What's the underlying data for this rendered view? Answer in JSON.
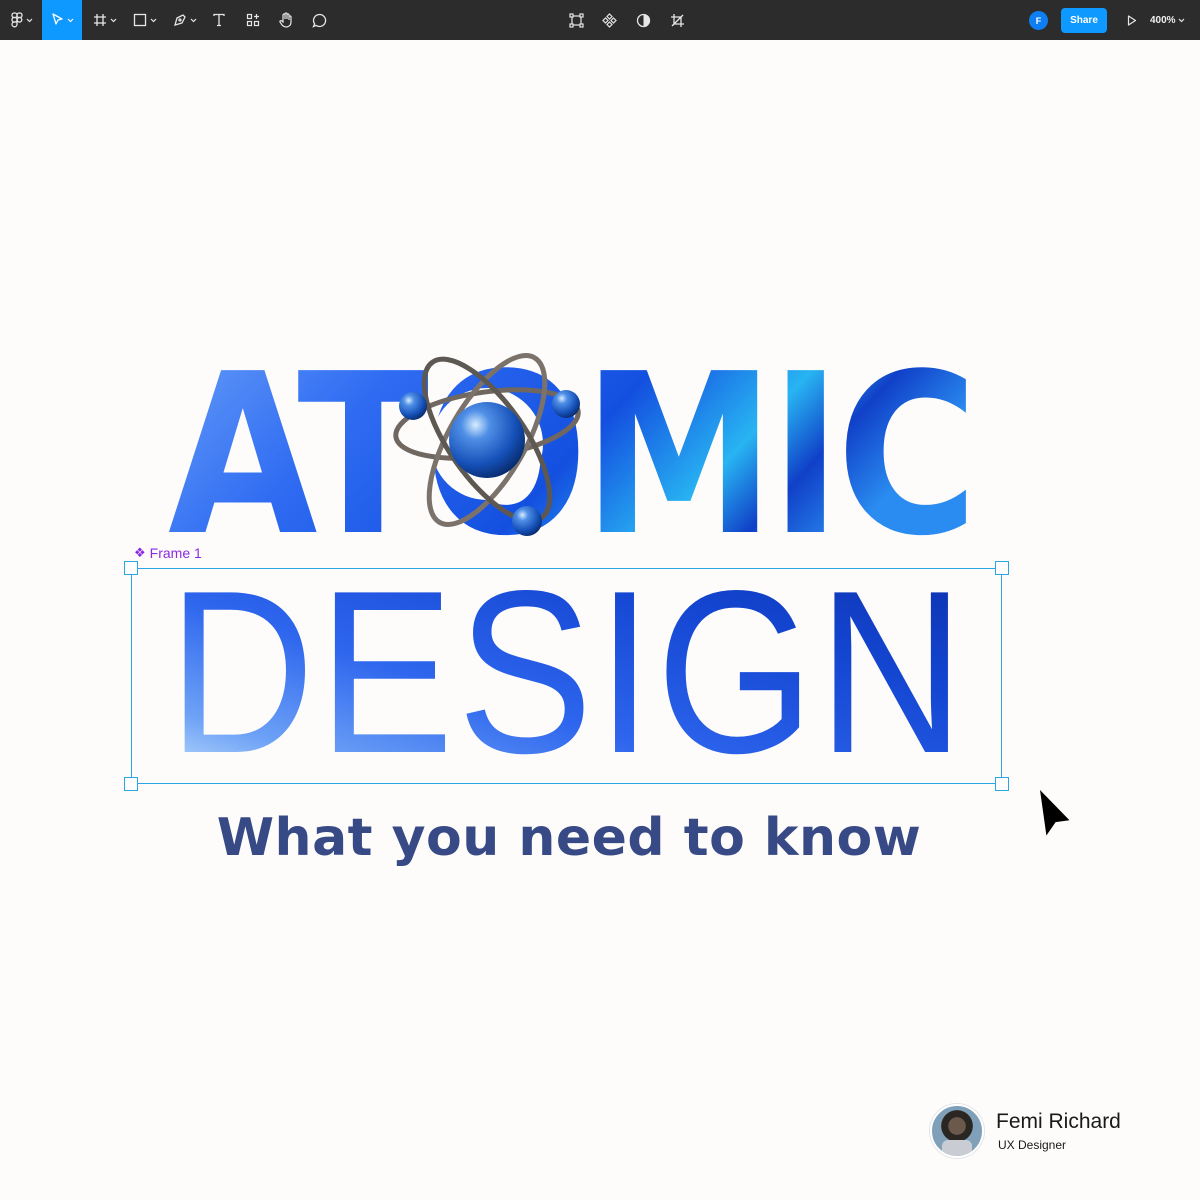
{
  "toolbar": {
    "user_initial": "F",
    "share_label": "Share",
    "zoom_level": "400%",
    "accent_color": "#0d99ff",
    "tools": [
      {
        "name": "main-menu",
        "icon": "figma-logo-icon"
      },
      {
        "name": "move",
        "icon": "move-arrow-icon",
        "active": true
      },
      {
        "name": "frame",
        "icon": "frame-hash-icon"
      },
      {
        "name": "shape",
        "icon": "rectangle-icon"
      },
      {
        "name": "pen",
        "icon": "pen-icon"
      },
      {
        "name": "text",
        "icon": "text-icon"
      },
      {
        "name": "resources",
        "icon": "resources-icon"
      },
      {
        "name": "hand",
        "icon": "hand-icon"
      },
      {
        "name": "comment",
        "icon": "comment-icon"
      },
      {
        "name": "transform",
        "icon": "transform-icon"
      },
      {
        "name": "component",
        "icon": "component-icon"
      },
      {
        "name": "mask",
        "icon": "contrast-icon"
      },
      {
        "name": "crop",
        "icon": "crop-icon"
      },
      {
        "name": "present",
        "icon": "play-icon"
      }
    ]
  },
  "canvas": {
    "frame_label": "Frame 1",
    "headline_top": "ATOMIC",
    "headline_bottom": "DESIGN",
    "subtitle": "What you need to know",
    "selection_color": "#2aa7e0",
    "frame_label_color": "#8a2be2"
  },
  "author": {
    "name": "Femi Richard",
    "role": "UX Designer"
  }
}
